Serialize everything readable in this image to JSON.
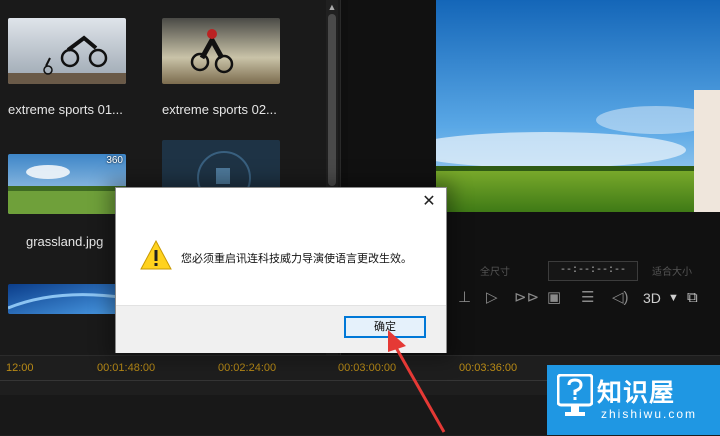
{
  "media": {
    "items": [
      {
        "label": "extreme sports 01...",
        "badge": ""
      },
      {
        "label": "extreme sports 02...",
        "badge": ""
      },
      {
        "label": "grassland.jpg",
        "badge": "360"
      },
      {
        "label": "",
        "badge": ""
      },
      {
        "label": "",
        "badge": ""
      }
    ]
  },
  "scrollbar": {
    "up_icon": "▲"
  },
  "preview": {
    "timecode": "--:--:--:--",
    "mode_label": "全尺寸",
    "fit_label": "适合大小",
    "three_d_label": "3D"
  },
  "timeline": {
    "ticks": [
      "12:00",
      "00:01:48:00",
      "00:02:24:00",
      "00:03:00:00",
      "00:03:36:00"
    ]
  },
  "dialog": {
    "close_icon": "✕",
    "message": "您必须重启讯连科技威力导演使语言更改生效。",
    "ok_label": "确定"
  },
  "logo": {
    "name": "知识屋",
    "url": "zhishiwu.com"
  },
  "colors": {
    "ok_border": "#0078d7",
    "timeline_ticks": "#b88a16",
    "logo_bg": "#1f97e3",
    "arrow": "#e53935"
  }
}
